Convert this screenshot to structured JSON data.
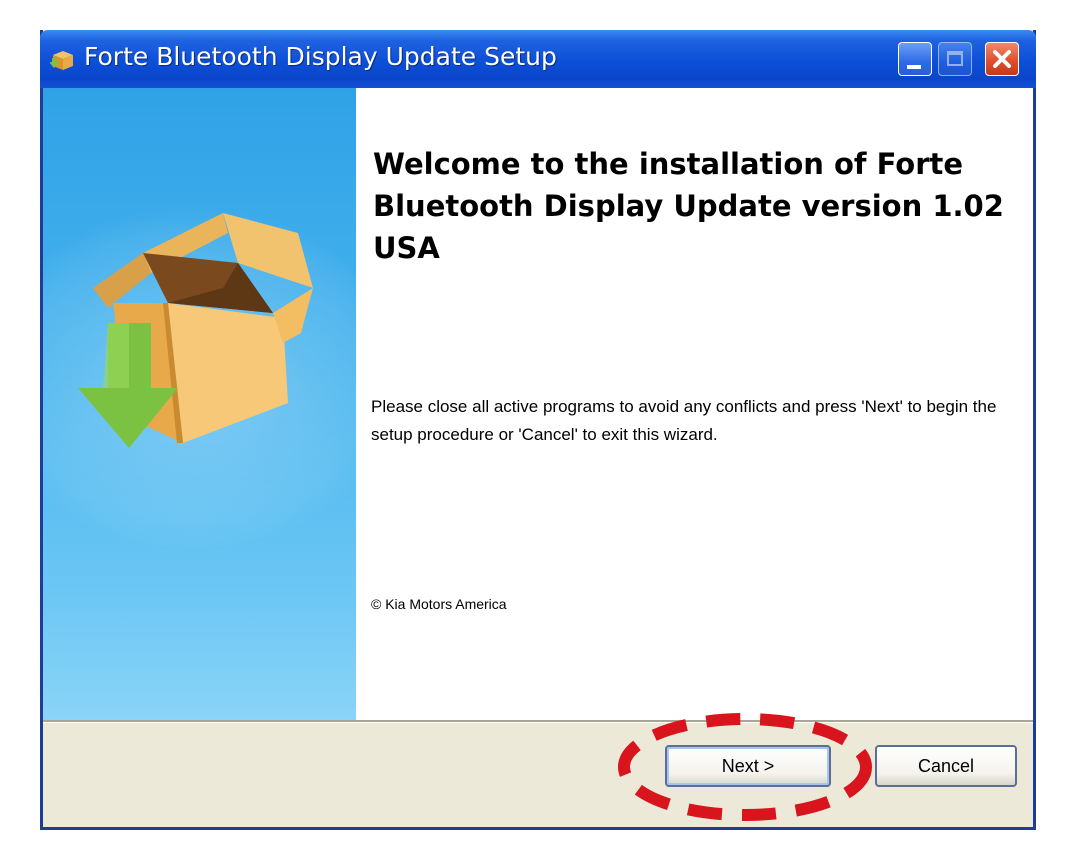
{
  "window": {
    "title": "Forte Bluetooth Display Update Setup"
  },
  "main": {
    "heading": "Welcome to the installation of Forte Bluetooth Display Update version 1.02 USA",
    "instructions": "Please close all active programs to avoid any conflicts and press 'Next' to begin the setup procedure or 'Cancel' to exit this wizard.",
    "copyright": "© Kia Motors America"
  },
  "footer": {
    "next_label": "Next >",
    "cancel_label": "Cancel"
  },
  "icons": {
    "title": "installer-box-icon",
    "sidebar": "box-download-icon",
    "minimize": "minimize-icon",
    "maximize": "maximize-icon",
    "close": "close-icon"
  },
  "colors": {
    "titlebar": "#0c4fd8",
    "sidebar": "#48b4ee",
    "close_button": "#e0502e",
    "highlight": "#d8141c",
    "dialog_background": "#ece9d8"
  },
  "annotation": {
    "type": "dashed-ellipse",
    "target": "next-button"
  }
}
